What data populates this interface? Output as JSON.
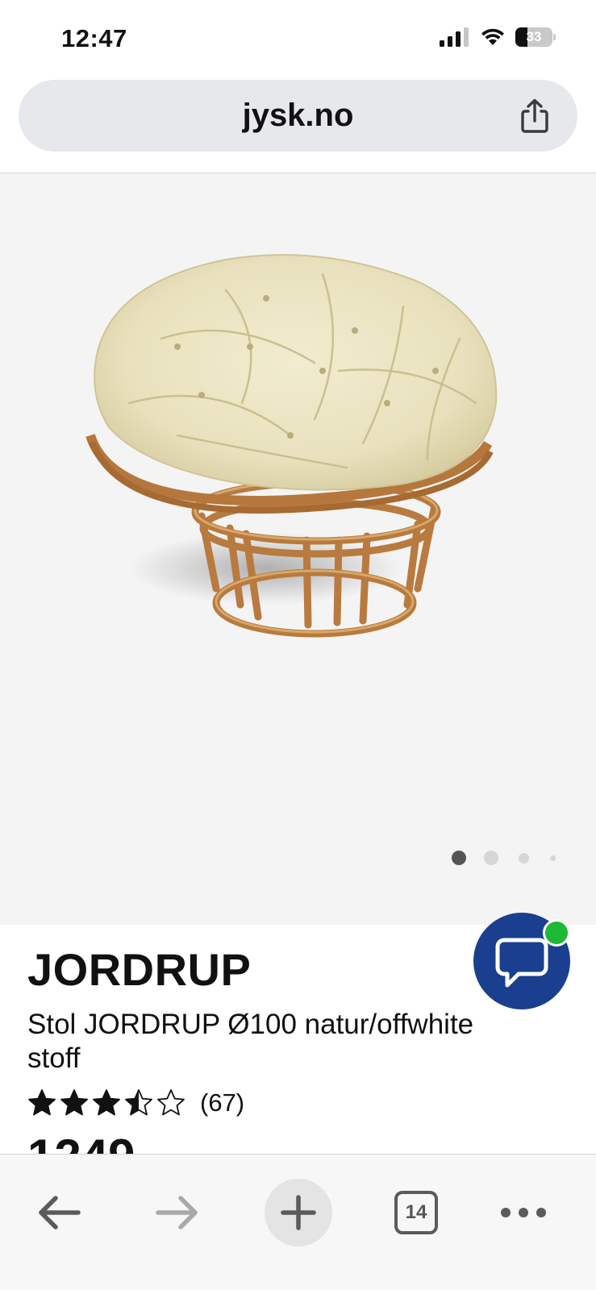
{
  "status_bar": {
    "time": "12:47",
    "battery": "33",
    "battery_level": 0.33
  },
  "browser": {
    "url": "jysk.no",
    "tab_count": "14"
  },
  "gallery": {
    "image_alt": "Stol JORDRUP Ø100 natur/offwhite stoff",
    "slide_count": 4,
    "active_slide": 1
  },
  "product": {
    "title": "JORDRUP",
    "subtitle": "Stol JORDRUP Ø100 natur/offwhite stoff",
    "rating": 3.5,
    "rating_max": 5,
    "review_count": "(67)",
    "price_partial": "1249"
  },
  "chat": {
    "online_color": "#1bb934",
    "button_color": "#1a3f8f"
  },
  "icons": {
    "share": "share-icon",
    "back": "arrow-left-icon",
    "forward": "arrow-right-icon",
    "new_tab": "plus-icon",
    "tabs": "tabs-icon",
    "more": "more-dots-icon",
    "chat": "chat-bubble-icon"
  }
}
